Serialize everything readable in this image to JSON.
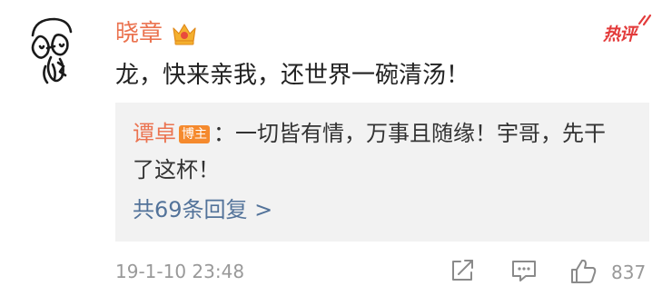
{
  "comment": {
    "username": "晓章",
    "text": "龙，快来亲我，还世界一碗清汤！",
    "hot_label": "热评",
    "timestamp": "19-1-10 23:48",
    "like_count": "837"
  },
  "reply": {
    "author": "谭卓",
    "badge": "博主",
    "text": "：一切皆有情，万事且随缘！宇哥，先干了这杯！",
    "more_replies_label": "共69条回复 >"
  },
  "colors": {
    "username": "#eb7350",
    "hot_label": "#e33b3b",
    "badge_bg": "#f58a2e",
    "link": "#53739a",
    "meta": "#999999"
  },
  "icons": {
    "avatar": "sketch-face-avatar",
    "user_badge": "crown-icon",
    "share": "share-icon",
    "reply": "comment-icon",
    "like": "thumbs-up-icon"
  }
}
